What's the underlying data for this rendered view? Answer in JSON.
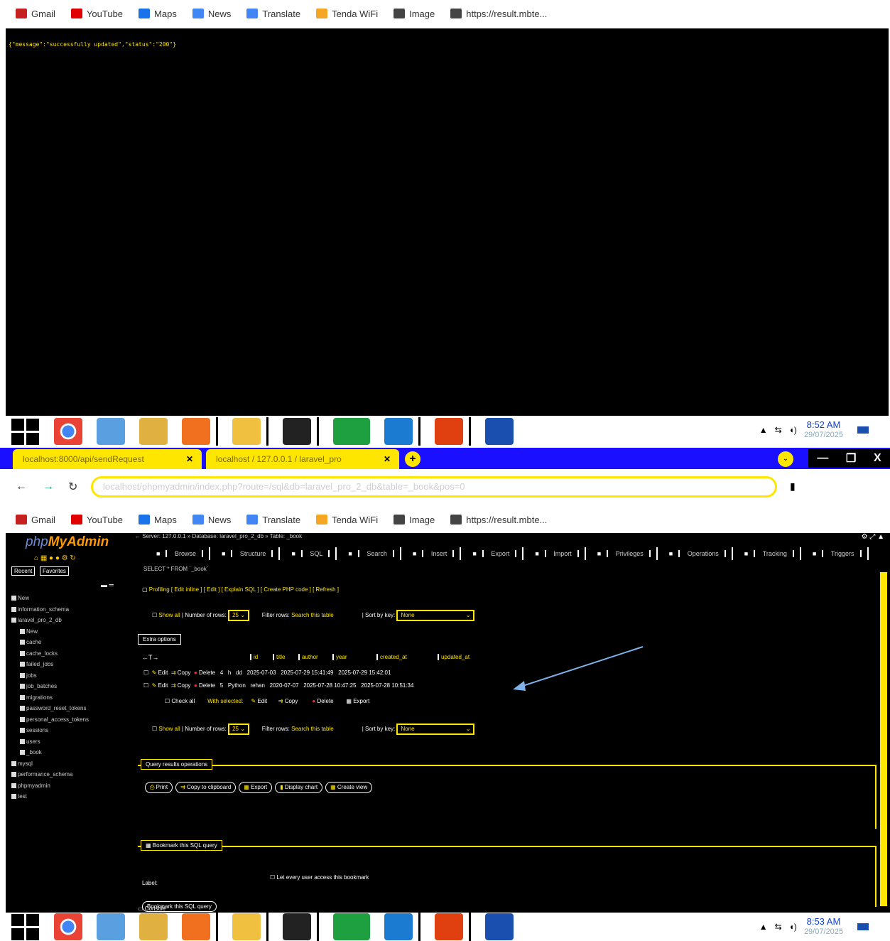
{
  "bookmarks": [
    {
      "label": "Gmail",
      "color": "#c5221f"
    },
    {
      "label": "YouTube",
      "color": "#e00000"
    },
    {
      "label": "Maps",
      "color": "#1a73e8"
    },
    {
      "label": "News",
      "color": "#4285f4"
    },
    {
      "label": "Translate",
      "color": "#4285f4"
    },
    {
      "label": "Tenda WiFi",
      "color": "#f5a623"
    },
    {
      "label": "Image",
      "color": "#444"
    },
    {
      "label": "https://result.mbte...",
      "color": "#444"
    }
  ],
  "api_response": "{\"message\":\"successfully updated\",\"status\":\"200\"}",
  "taskbar": {
    "time1": "8:52 AM",
    "date1": "29/07/2025",
    "time2": "8:53 AM",
    "date2": "29/07/2025"
  },
  "tabs": [
    {
      "title": "localhost:8000/api/sendRequest"
    },
    {
      "title": "localhost / 127.0.0.1 / laravel_pro"
    }
  ],
  "address": "localhost/phpmyadmin/index.php?route=/sql&db=laravel_pro_2_db&table=_book&pos=0",
  "pma": {
    "logo_a": "php",
    "logo_b": "MyAdmin",
    "recent": "Recent",
    "favorites": "Favorites",
    "breadcrumb": "Server: 127.0.0.1 » Database: laravel_pro_2_db » Table: _book",
    "menu": [
      "Browse",
      "Structure",
      "SQL",
      "Search",
      "Insert",
      "Export",
      "Import",
      "Privileges",
      "Operations",
      "Tracking",
      "Triggers"
    ],
    "query": "SELECT * FROM `_book`",
    "profiling": "Profiling [ Edit inline ] [ Edit ] [ Explain SQL ] [ Create PHP code ] [ Refresh ]",
    "show_all": "Show all",
    "num_rows_label": "Number of rows:",
    "num_rows": "25",
    "filter_label": "Filter rows:",
    "filter_placeholder": "Search this table",
    "sort_label": "Sort by key:",
    "sort_value": "None",
    "extra_options": "Extra options",
    "columns": [
      "id",
      "title",
      "author",
      "year",
      "created_at",
      "updated_at"
    ],
    "rows": [
      {
        "id": "4",
        "title": "h",
        "author": "dd",
        "year": "2025-07-03",
        "created_at": "2025-07-29 15:41:49",
        "updated_at": "2025-07-29 15:42:01"
      },
      {
        "id": "5",
        "title": "Python",
        "author": "rehan",
        "year": "2020-07-07",
        "created_at": "2025-07-28 10:47:25",
        "updated_at": "2025-07-28 10:51:34"
      }
    ],
    "row_actions": {
      "edit": "Edit",
      "copy": "Copy",
      "delete": "Delete"
    },
    "check_all": "Check all",
    "with_selected": "With selected:",
    "export": "Export",
    "qro_legend": "Query results operations",
    "qro_buttons": [
      "Print",
      "Copy to clipboard",
      "Export",
      "Display chart",
      "Create view"
    ],
    "bm_legend": "Bookmark this SQL query",
    "label": "Label:",
    "let_every": "Let every user access this bookmark",
    "bm_button": "Bookmark this SQL query",
    "console": "Console",
    "tree": [
      "New",
      "information_schema",
      "laravel_pro_2_db",
      "New",
      "cache",
      "cache_locks",
      "failed_jobs",
      "jobs",
      "job_batches",
      "migrations",
      "password_reset_tokens",
      "personal_access_tokens",
      "sessions",
      "users",
      "_book",
      "mysql",
      "performance_schema",
      "phpmyadmin",
      "test"
    ]
  }
}
